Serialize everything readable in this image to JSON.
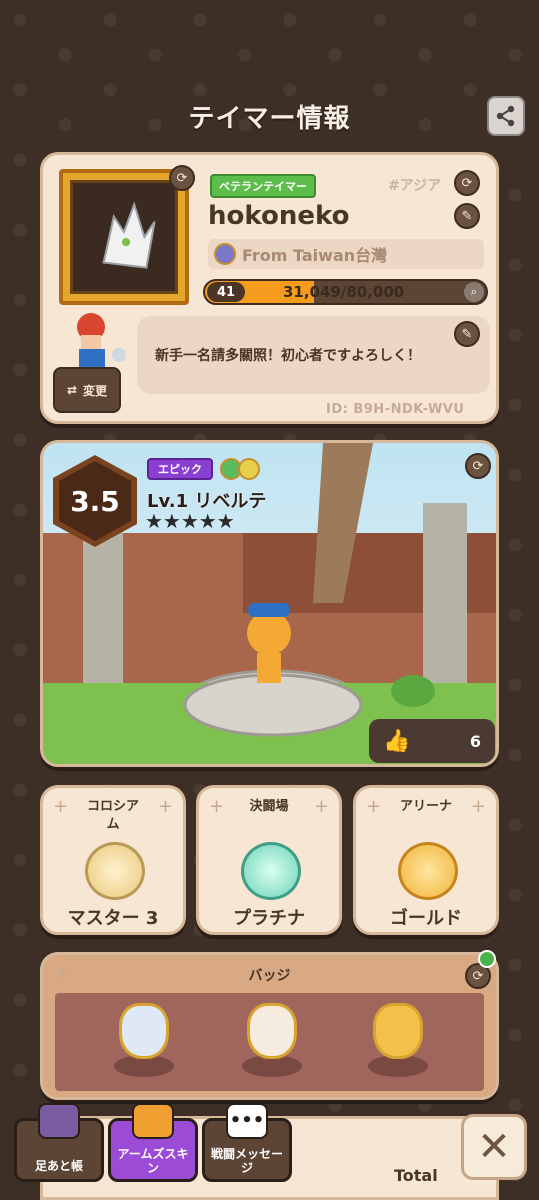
{
  "header": {
    "title": "テイマー情報"
  },
  "profile": {
    "title_badge": "ベテランテイマー",
    "region": "#アジア",
    "username": "hokoneko",
    "from": "From Taiwan台灣",
    "level": "41",
    "exp_text": "31,049/80,000",
    "exp_current": 31049,
    "exp_max": 80000,
    "message": "新手一名請多關照！初心者ですよろしく！",
    "change_label": "変更",
    "player_id": "ID: B9H-NDK-WVU"
  },
  "pet": {
    "rank": "3.5",
    "rarity": "エピック",
    "name": "Lv.1 リベルテ",
    "stars": "★★★★★",
    "likes": "6"
  },
  "leagues": [
    {
      "title": "コロシア\nム",
      "rank": "マスター 3",
      "emblem_color": "#e9c77a"
    },
    {
      "title": "決闘場",
      "rank": "プラチナ",
      "emblem_color": "#6fd3b6"
    },
    {
      "title": "アリーナ",
      "rank": "ゴールド",
      "emblem_color": "#f0b43a"
    }
  ],
  "badges": {
    "title": "バッジ"
  },
  "bottom_nav": [
    {
      "label": "足あと帳",
      "color": "#5c4535"
    },
    {
      "label": "アームズスキン",
      "color": "#9b4bd6"
    },
    {
      "label": "戦闘メッセージ",
      "color": "#5c4535"
    }
  ],
  "footer": {
    "total_label": "Total"
  }
}
